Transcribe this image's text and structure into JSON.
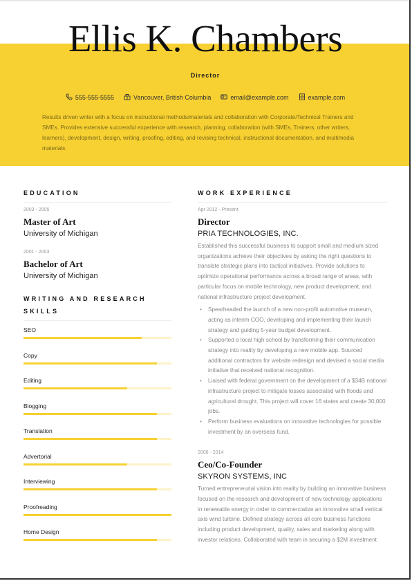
{
  "header": {
    "name": "Ellis K. Chambers",
    "headline": "Director",
    "contacts": [
      {
        "icon": "phone-icon",
        "text": "555-555-5555"
      },
      {
        "icon": "location-icon",
        "text": "Vancouver, British Columbia"
      },
      {
        "icon": "email-icon",
        "text": "email@example.com"
      },
      {
        "icon": "website-icon",
        "text": "example.com"
      }
    ],
    "summary": "Results driven writer with a focus on instructional methods/materials and collaboration with Corporate/Technical Trainers and SMEs. Provides extensive successful experience with research, planning, collaboration (with SMEs, Trainers, other writers, learners), development, design, writing, proofing, editing, and revising technical, instructional documentation, and multimedia materials."
  },
  "colors": {
    "accent": "#F7D032",
    "accent_light": "#FDF3C9"
  },
  "education": {
    "title": "EDUCATION",
    "items": [
      {
        "dates": "2003 - 2005",
        "degree": "Master of Art",
        "school": "University of Michigan"
      },
      {
        "dates": "2001 - 2003",
        "degree": "Bachelor of Art",
        "school": "University of Michigan"
      }
    ]
  },
  "skills": {
    "title": "WRITING AND RESEARCH SKILLS",
    "items": [
      {
        "label": "SEO",
        "level": 0.8
      },
      {
        "label": "Copy",
        "level": 0.9
      },
      {
        "label": "Editing",
        "level": 0.7
      },
      {
        "label": "Blogging",
        "level": 0.9
      },
      {
        "label": "Translation",
        "level": 0.9
      },
      {
        "label": "Advertorial",
        "level": 0.7
      },
      {
        "label": "Interviewing",
        "level": 0.9
      },
      {
        "label": "Proofreading",
        "level": 1.0
      },
      {
        "label": "Home Design",
        "level": 0.9
      }
    ]
  },
  "experience": {
    "title": "WORK EXPERIENCE",
    "jobs": [
      {
        "dates": "Apr 2012 - Present",
        "role": "Director",
        "company": "PRIA TECHNOLOGIES, INC.",
        "description": "Established this successful business to support small and medium sized organizations achieve their objectives by asking the right questions to translate strategic plans into tactical initiatives. Provide solutions to optimize operational performance across a broad range of areas, with particular focus on mobile technology, new product development, and national infrastructure project development.",
        "bullets": [
          "Spearheaded the launch of a new non-profit automotive museum, acting as interim COO, developing and implementing their launch strategy and guiding 5-year budget development.",
          "Supported a local high school by transforming their communication strategy into reality by developing a new mobile app. Sourced additional contractors for website redesign and devised a social media initiative that received national recognition.",
          "Liaised with federal government on the development of a $34B national infrastructure project to mitigate losses associated with floods and agricultural drought. This project will cover 16 states and create 30,000 jobs.",
          "Perform business evaluations on innovative technologies for possible investment by an overseas fund."
        ]
      },
      {
        "dates": "2006 - 2014",
        "role": "Ceo/Co-Founder",
        "company": "SKYRON SYSTEMS, INC",
        "description": "Turned entrepreneurial vision into reality by building an innovative business focused on the research and development of new technology applications in renewable energy in order to commercialize an innovative small vertical axis wind turbine. Defined strategy across all core business functions including product development, quality, sales and marketing along with investor relations. Collaborated with team in securing a $2M investment"
      }
    ]
  }
}
